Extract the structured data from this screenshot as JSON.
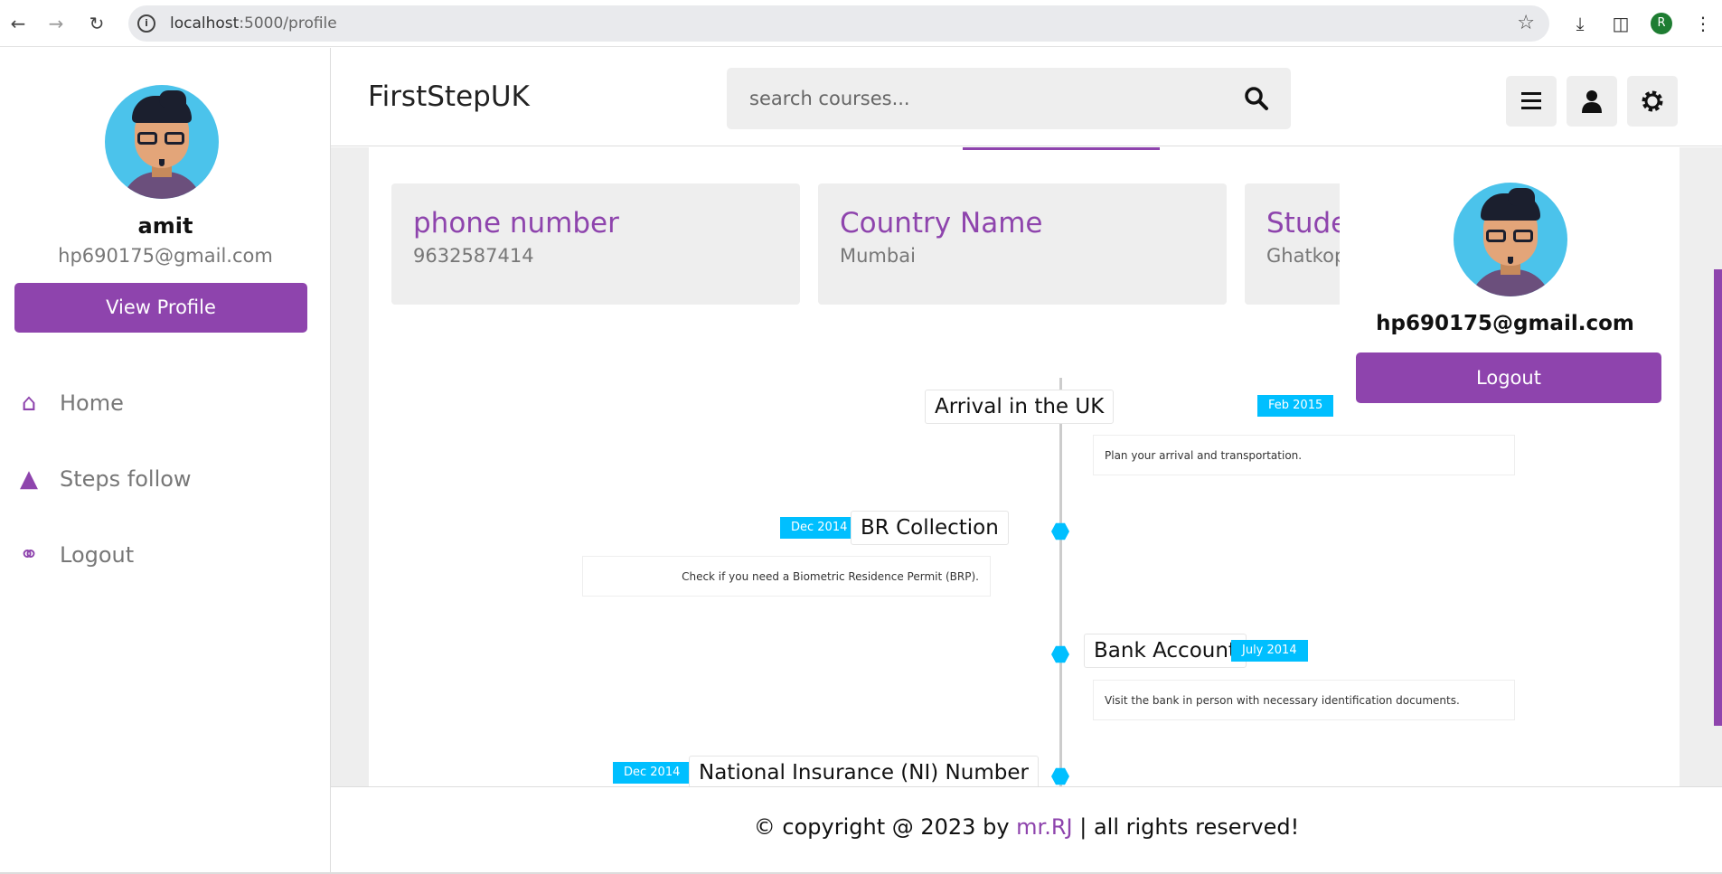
{
  "browser": {
    "url_host": "localhost",
    "url_path": ":5000/profile",
    "profile_initial": "R"
  },
  "sidebar": {
    "name": "amit",
    "email": "hp690175@gmail.com",
    "view_profile": "View Profile",
    "nav": [
      {
        "label": "Home",
        "icon": "home-icon"
      },
      {
        "label": "Steps follow",
        "icon": "graduation-cap-icon"
      },
      {
        "label": "Logout",
        "icon": "headset-icon"
      }
    ]
  },
  "header": {
    "brand": "FirstStepUK",
    "search_placeholder": "search courses..."
  },
  "cards": [
    {
      "title": "phone number",
      "value": "9632587414"
    },
    {
      "title": "Country Name",
      "value": "Mumbai"
    },
    {
      "title": "Student",
      "value": "Ghatkopar"
    }
  ],
  "timeline": [
    {
      "title": "Arrival in the UK",
      "date": "Feb 2015",
      "desc": "Plan your arrival and transportation.",
      "side": "right"
    },
    {
      "title": "BR Collection",
      "date": "Dec 2014",
      "desc": "Check if you need a Biometric Residence Permit (BRP).",
      "side": "left"
    },
    {
      "title": "Bank Account",
      "date": "July 2014",
      "desc": "Visit the bank in person with necessary identification documents.",
      "side": "right"
    },
    {
      "title": "National Insurance (NI) Number",
      "date": "Dec 2014",
      "desc": "",
      "side": "left"
    }
  ],
  "dropdown": {
    "email": "hp690175@gmail.com",
    "logout": "Logout"
  },
  "footer": {
    "prefix": "© copyright @ 2023 by ",
    "author": "mr.RJ",
    "suffix": " | all rights reserved!"
  },
  "colors": {
    "accent": "#8e44ad",
    "timeline": "#00bfff"
  }
}
